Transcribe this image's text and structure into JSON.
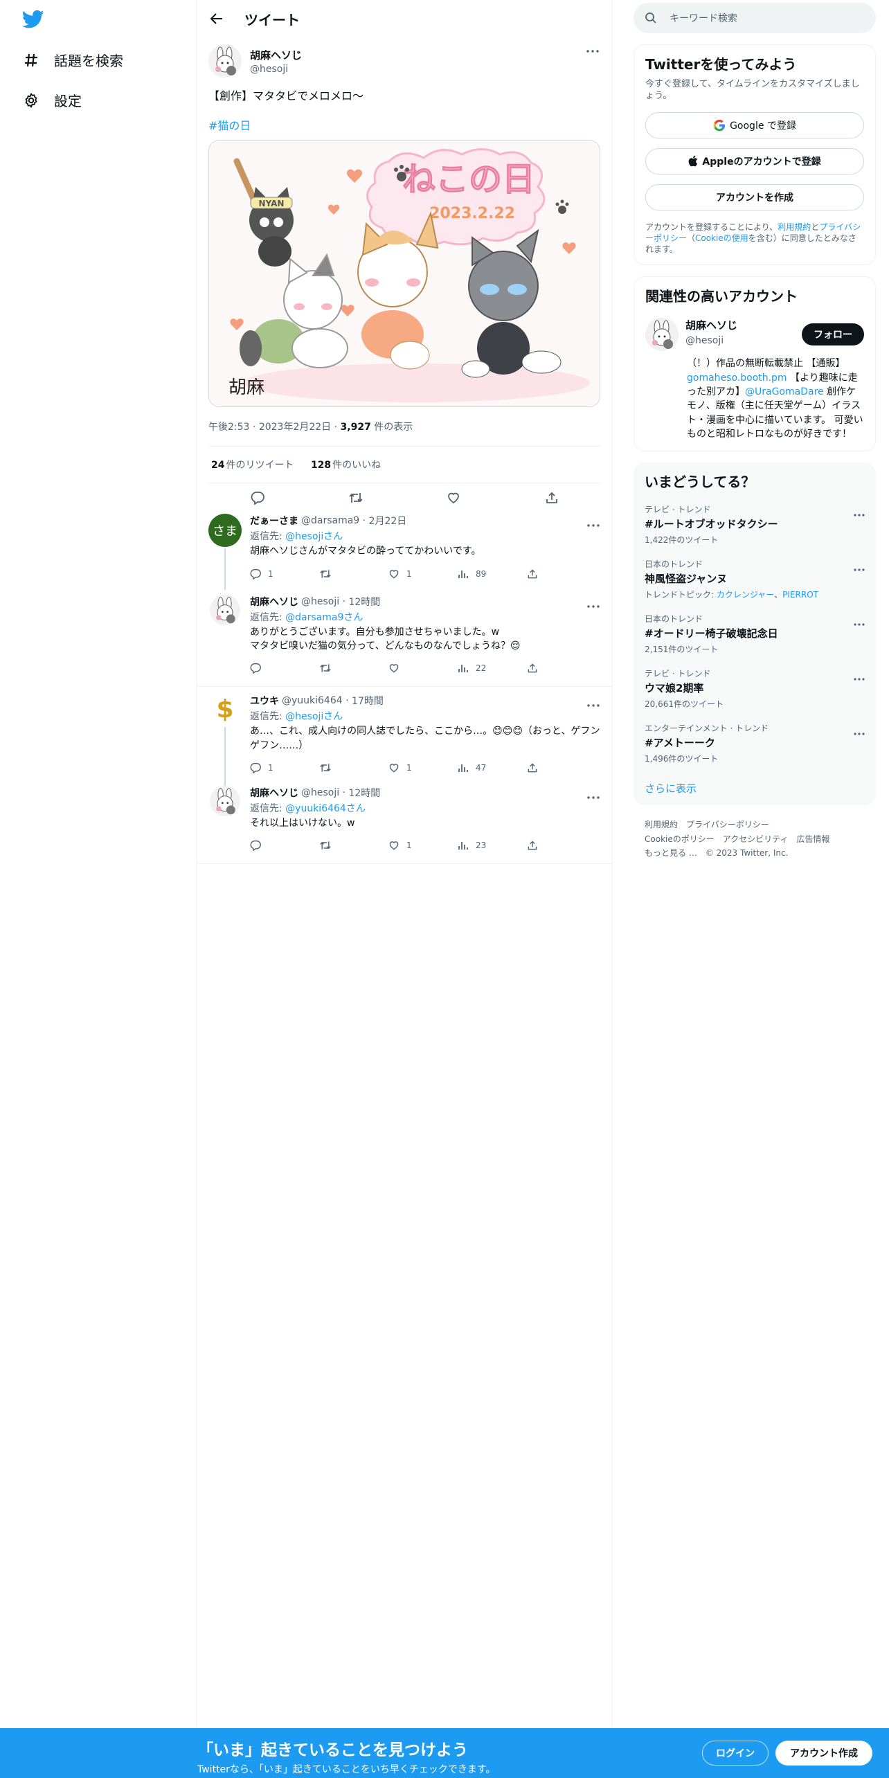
{
  "colors": {
    "accent": "#1d9bf0",
    "text": "#0f1419",
    "muted": "#536471",
    "border": "#eff3f4"
  },
  "nav": {
    "logo_icon": "twitter-bird-icon",
    "items": [
      {
        "icon": "hashtag-icon",
        "label": "話題を検索"
      },
      {
        "icon": "gear-icon",
        "label": "設定"
      }
    ]
  },
  "header": {
    "title": "ツイート"
  },
  "tweet": {
    "author_name": "胡麻ヘソじ",
    "author_handle": "@hesoji",
    "text": "【創作】マタタビでメロメロ〜",
    "hashtag": "#猫の日",
    "image_alt": "ねこの日 2023.2.22",
    "image_title": "ねこの日",
    "image_date": "2023.2.22",
    "image_nyan": "NYAN",
    "time": "午後2:53",
    "date": "2023年2月22日",
    "views": "3,927",
    "views_label": "件の表示",
    "retweets": "24",
    "retweets_label": "件のリツイート",
    "likes": "128",
    "likes_label": "件のいいね"
  },
  "replies": [
    {
      "name": "だぁーさま",
      "handle": "@darsama9",
      "time": "2月22日",
      "reply_prefix": "返信先:",
      "reply_to": "@hesojiさん",
      "text": "胡麻ヘソじさんがマタタビの酔っててかわいいです。",
      "avatar_text": "さま",
      "counts": {
        "reply": "1",
        "retweet": "",
        "like": "1",
        "views": "89"
      }
    },
    {
      "name": "胡麻ヘソじ",
      "handle": "@hesoji",
      "time": "12時間",
      "reply_prefix": "返信先:",
      "reply_to": "@darsama9さん",
      "text": "ありがとうございます。自分も参加させちゃいました。w",
      "text2": "マタタビ嗅いだ猫の気分って、どんなものなんでしょうね？😌",
      "counts": {
        "reply": "",
        "retweet": "",
        "like": "",
        "views": "22"
      }
    },
    {
      "name": "ユウキ",
      "handle": "@yuuki6464",
      "time": "17時間",
      "reply_prefix": "返信先:",
      "reply_to": "@hesojiさん",
      "text": "あ…、これ、成人向けの同人誌でしたら、ここから…。😊😊😊（おっと、ゲフンゲフン……）",
      "avatar_text": "$",
      "counts": {
        "reply": "1",
        "retweet": "",
        "like": "1",
        "views": "47"
      }
    },
    {
      "name": "胡麻ヘソじ",
      "handle": "@hesoji",
      "time": "12時間",
      "reply_prefix": "返信先:",
      "reply_to": "@yuuki6464さん",
      "text": "それ以上はいけない。w",
      "counts": {
        "reply": "",
        "retweet": "",
        "like": "1",
        "views": "23"
      }
    }
  ],
  "search": {
    "placeholder": "キーワード検索"
  },
  "signup_card": {
    "title": "Twitterを使ってみよう",
    "sub": "今すぐ登録して、タイムラインをカスタマイズしましょう。",
    "google": "Google で登録",
    "apple": "Appleのアカウントで登録",
    "create": "アカウントを作成",
    "legal_1": "アカウントを登録することにより、",
    "legal_terms": "利用規約",
    "legal_2": "と",
    "legal_privacy": "プライバシーポリシー",
    "legal_3": "（",
    "legal_cookie": "Cookieの使用",
    "legal_4": "を含む）に同意したとみなされます。"
  },
  "related": {
    "title": "関連性の高いアカウント",
    "name": "胡麻ヘソじ",
    "handle": "@hesoji",
    "follow": "フォロー",
    "bio_1": "（！）作品の無断転載禁止 【通販】",
    "bio_link1": "gomaheso.booth.pm",
    "bio_2": " 【より趣味に走った別アカ】",
    "bio_link2": "@UraGomaDare",
    "bio_3": " 創作ケモノ、版権（主に任天堂ゲーム）イラスト・漫画を中心に描いています。 可愛いものと昭和レトロなものが好きです！"
  },
  "trends": {
    "title": "いまどうしてる？",
    "items": [
      {
        "context": "テレビ · トレンド",
        "name": "#ルートオブオッドタクシー",
        "count": "1,422件のツイート"
      },
      {
        "context": "日本のトレンド",
        "name": "神風怪盗ジャンヌ",
        "topic_prefix": "トレンドトピック: ",
        "topic1": "カクレンジャー",
        "topic2": "PIERROT"
      },
      {
        "context": "日本のトレンド",
        "name": "#オードリー椅子破壊記念日",
        "count": "2,151件のツイート"
      },
      {
        "context": "テレビ · トレンド",
        "name": "ウマ娘2期率",
        "count": "20,661件のツイート"
      },
      {
        "context": "エンターテインメント · トレンド",
        "name": "#アメトーーク",
        "count": "1,496件のツイート"
      }
    ],
    "show_more": "さらに表示"
  },
  "footer": {
    "links": [
      "利用規約",
      "プライバシーポリシー",
      "Cookieのポリシー",
      "アクセシビリティ",
      "広告情報",
      "もっと見る …",
      "© 2023 Twitter, Inc."
    ]
  },
  "bottom_bar": {
    "title": "「いま」起きていることを見つけよう",
    "sub": "Twitterなら、「いま」起きていることをいち早くチェックできます。",
    "login": "ログイン",
    "signup": "アカウント作成"
  }
}
